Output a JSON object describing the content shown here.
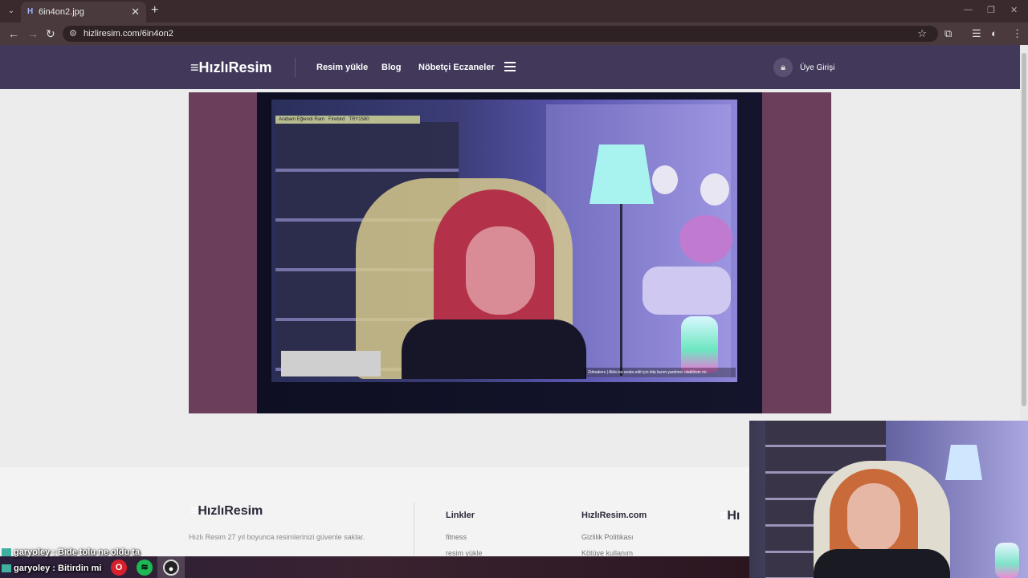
{
  "browser": {
    "tab_title": "6in4on2.jpg",
    "tab_favicon": "H",
    "url": "hizliresim.com/6in4on2",
    "new_tab": "+",
    "tab_close": "✕",
    "back": "←",
    "forward": "→",
    "reload": "↻"
  },
  "header": {
    "logo": "HızlıResim",
    "nav": [
      "Resim yükle",
      "Blog",
      "Nöbetçi Eczaneler"
    ],
    "login": "Üye Girişi"
  },
  "image": {
    "overlay_top_left": "Arabam Eğlendi Ram",
    "overlay_top_mid": "Firebird",
    "overlay_top_right": "TRY1580",
    "caption": "Zdmakers | Akla ise ansta edit için kitp lazım yardımcı olabilirsin mi."
  },
  "footer": {
    "logo": "HızlıResim",
    "description": "Hızlı Resim 27 yıl boyunca resimlerinizi güvenle saklar.",
    "col1_title": "Linkler",
    "col1_links": [
      "fitness",
      "resim yükle"
    ],
    "col2_title": "HızlıResim.com",
    "col2_links": [
      "Gizlilik Politikası",
      "Kötüye kullanım"
    ],
    "partial_logo": "Hı"
  },
  "chat": [
    {
      "user": "garyoley",
      "message": "Bide tolu ne oldu ta"
    },
    {
      "user": "garyoley",
      "message": "Bitirdin mi"
    }
  ],
  "taskbar": {
    "icons": [
      "opera-icon",
      "spotify-icon",
      "obs-icon"
    ]
  },
  "colors": {
    "header_bg": "#42385a",
    "frame_bg": "#6b3f5c",
    "browser_bg": "#3a2a2e"
  }
}
